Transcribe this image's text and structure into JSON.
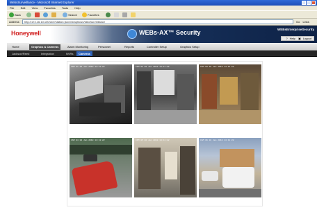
{
  "browser": {
    "window_title": "WebsSurveillance - Microsoft Internet Explorer",
    "menu": [
      "File",
      "Edit",
      "View",
      "Favorites",
      "Tools",
      "Help"
    ],
    "toolbar": {
      "back": "Back",
      "search": "Search",
      "favorites": "Favorites"
    },
    "address_label": "Address",
    "address_value": "http://172.16.10.100/ord?station:|slot:/Graphics/VideoSurveillance",
    "go_label": "Go",
    "links_label": "Links"
  },
  "app": {
    "logo": "Honeywell",
    "product": "WEBs-AX™ Security",
    "suite": "WEBsEnterpriseSecurity",
    "header_links": [
      "Help",
      "Logout"
    ]
  },
  "tabs": [
    "Home",
    "Graphics & Cameras",
    "Alarm Monitoring",
    "Personnel",
    "Reports",
    "Controller Setup",
    "Graphics Setup"
  ],
  "active_tab": "Graphics & Cameras",
  "subtabs": [
    "Jackson/Reed",
    "Integration",
    "NVRs",
    "Cameras"
  ],
  "active_subtab": "Cameras",
  "cameras": [
    {
      "stamp": "CAM 01  02 Jan 2010 14:11:22"
    },
    {
      "stamp": "CAM 02  02 Jan 2010 14:11:22"
    },
    {
      "stamp": "CAM 03  02 Jan 2010 14:11:22"
    },
    {
      "stamp": "CAM 04  02 Jan 2010 14:11:22"
    },
    {
      "stamp": "CAM 05  02 Jan 2010 14:11:22"
    },
    {
      "stamp": "CAM 06  02 Jan 2010 14:11:22"
    }
  ]
}
